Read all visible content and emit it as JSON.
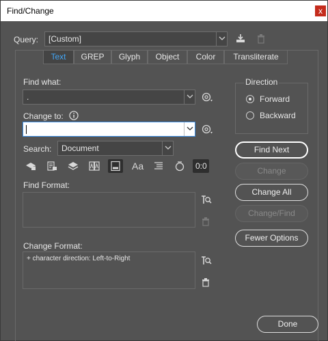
{
  "window": {
    "title": "Find/Change",
    "close_glyph": "x"
  },
  "query": {
    "label": "Query:",
    "value": "[Custom]",
    "save_icon": "save-query-icon",
    "delete_icon": "trash-icon"
  },
  "tabs": [
    {
      "label": "Text",
      "active": true
    },
    {
      "label": "GREP",
      "active": false
    },
    {
      "label": "Glyph",
      "active": false
    },
    {
      "label": "Object",
      "active": false
    },
    {
      "label": "Color",
      "active": false
    },
    {
      "label": "Transliterate",
      "active": false
    }
  ],
  "find_what": {
    "label": "Find what:",
    "value": "."
  },
  "change_to": {
    "label": "Change to:",
    "value": ""
  },
  "search": {
    "label": "Search:",
    "value": "Document"
  },
  "options_icons": [
    "include-locked-layers-icon",
    "include-locked-stories-icon",
    "include-hidden-layers-icon",
    "include-master-pages-icon",
    "include-footnotes-icon",
    "case-sensitive-icon",
    "whole-word-icon",
    "kana-sensitive-icon",
    "full-half-width-icon"
  ],
  "options_labels": {
    "case": "Aa",
    "width": "0:0"
  },
  "find_format": {
    "label": "Find Format:",
    "text": ""
  },
  "change_format": {
    "label": "Change Format:",
    "text": "+ character direction: Left-to-Right"
  },
  "direction": {
    "label": "Direction",
    "options": [
      {
        "label": "Forward",
        "selected": true
      },
      {
        "label": "Backward",
        "selected": false
      }
    ]
  },
  "buttons": {
    "find_next": "Find Next",
    "change": "Change",
    "change_all": "Change All",
    "change_find": "Change/Find",
    "fewer_options": "Fewer Options",
    "done": "Done"
  },
  "colors": {
    "accent": "#42a5f5",
    "panel": "#535353",
    "close": "#c42b1c"
  }
}
